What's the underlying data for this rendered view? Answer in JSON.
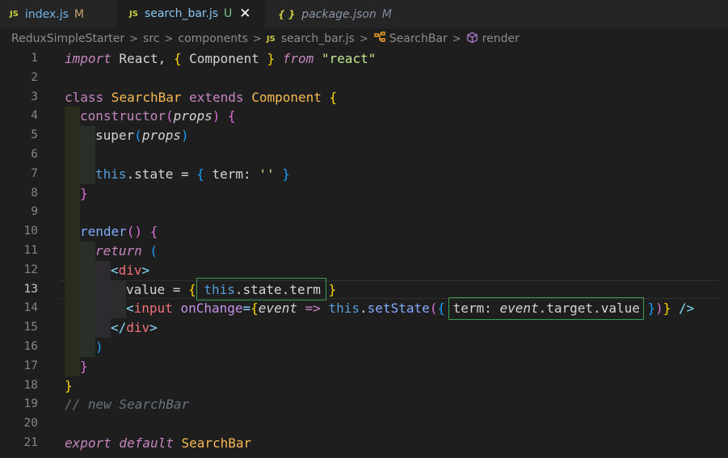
{
  "tabs": [
    {
      "badge": "JS",
      "label": "index.js",
      "status": "M"
    },
    {
      "badge": "JS",
      "label": "search_bar.js",
      "status": "U",
      "close": "✕"
    },
    {
      "badge": "{ }",
      "label": "package.json",
      "status": "M"
    }
  ],
  "breadcrumb": {
    "items": [
      "ReduxSimpleStarter",
      "src",
      "components",
      "search_bar.js",
      "SearchBar",
      "render"
    ],
    "file_badge": "JS",
    "separator": ">"
  },
  "editor": {
    "active_line": 13,
    "line_numbers": [
      "1",
      "2",
      "3",
      "4",
      "5",
      "6",
      "7",
      "8",
      "9",
      "10",
      "11",
      "12",
      "13",
      "14",
      "15",
      "16",
      "17",
      "18",
      "19",
      "20",
      "21"
    ],
    "tokens": {
      "l1": [
        "import",
        " React, ",
        "{",
        " Component ",
        "}",
        " from ",
        "\"react\""
      ],
      "l3": [
        "class",
        " SearchBar ",
        "extends",
        " Component ",
        "{"
      ],
      "l4": [
        "constructor",
        "(",
        "props",
        ")",
        " {"
      ],
      "l5": [
        "super",
        "(",
        "props",
        ")"
      ],
      "l7": [
        "this",
        ".state = ",
        "{",
        " term: ",
        "''",
        " }"
      ],
      "l8": [
        "}"
      ],
      "l10": [
        "render",
        "()",
        " {"
      ],
      "l11": [
        "return",
        " ("
      ],
      "l12": [
        "<",
        "div",
        ">"
      ],
      "l13": [
        "value",
        " = ",
        "{",
        " this",
        ".state.term ",
        "}"
      ],
      "l14": [
        "<",
        "input",
        " onChange",
        "=",
        "{",
        "event",
        " => ",
        "this",
        ".",
        "setState",
        "(",
        "{",
        " term: ",
        "event",
        ".target.value ",
        "}",
        ")",
        "}",
        " />"
      ],
      "l15": [
        "</",
        "div",
        ">"
      ],
      "l16": [
        ")"
      ],
      "l17": [
        "}"
      ],
      "l18": [
        "}"
      ],
      "l19": [
        "// new SearchBar"
      ],
      "l21": [
        "export",
        " default",
        " SearchBar"
      ]
    }
  }
}
